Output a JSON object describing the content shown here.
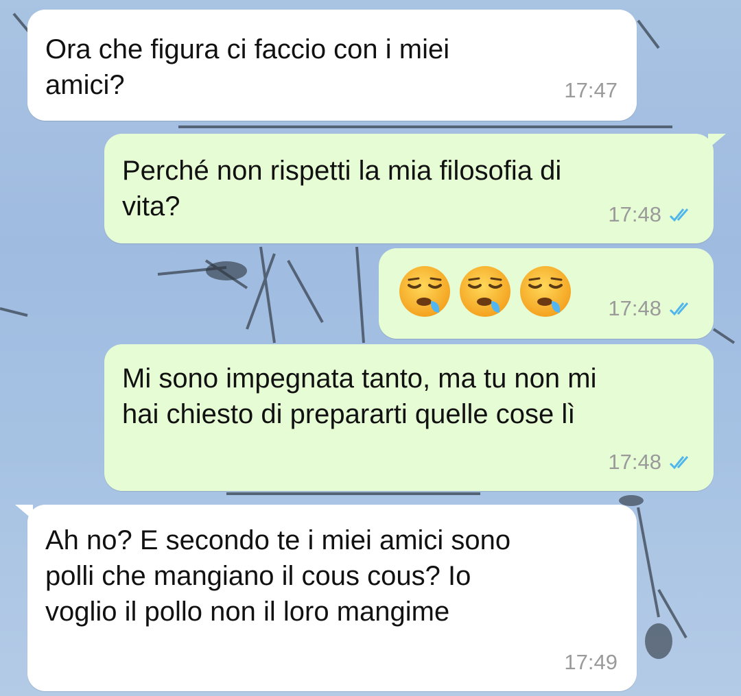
{
  "chat": {
    "messages": [
      {
        "direction": "in",
        "text": "Ora che figura ci faccio con i miei\namici?",
        "time": "17:47"
      },
      {
        "direction": "out",
        "text": "Perché non rispetti la mia filosofia di\nvita?",
        "time": "17:48",
        "status": "read"
      },
      {
        "direction": "out",
        "emojis": [
          "sleepy-face",
          "sleepy-face",
          "sleepy-face"
        ],
        "time": "17:48",
        "status": "read"
      },
      {
        "direction": "out",
        "text": "Mi sono impegnata tanto, ma tu non mi\nhai chiesto di prepararti quelle cose lì",
        "time": "17:48",
        "status": "read"
      },
      {
        "direction": "in",
        "text": "Ah no? E secondo te i miei amici sono\npolli che mangiano il cous cous? Io\nvoglio il pollo non il loro mangime",
        "time": "17:49"
      }
    ]
  },
  "colors": {
    "incoming_bubble": "#ffffff",
    "outgoing_bubble": "#e6fcd4",
    "read_ticks": "#4fb6ec",
    "timestamp": "#9a9a9a",
    "wallpaper_sky": "#a9c3e2"
  }
}
